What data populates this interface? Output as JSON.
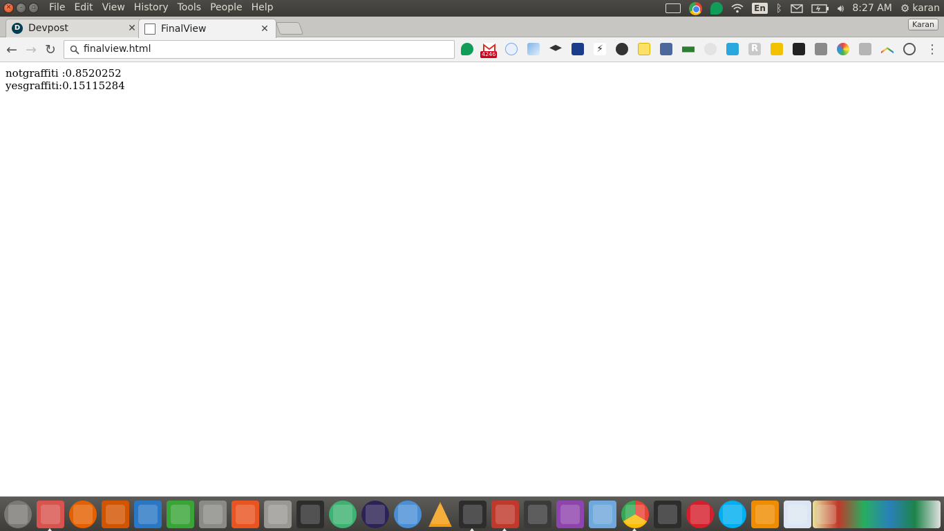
{
  "panel": {
    "menu": [
      "File",
      "Edit",
      "View",
      "History",
      "Tools",
      "People",
      "Help"
    ],
    "keyboard_layout": "En",
    "time": "8:27 AM",
    "user": "karan"
  },
  "tabs": [
    {
      "title": "Devpost",
      "favicon": "devpost-icon",
      "active": false
    },
    {
      "title": "FinalView",
      "favicon": "page-icon",
      "active": true
    }
  ],
  "profile": "Karan",
  "toolbar": {
    "url": "finalview.html",
    "gmail_badge": "4246"
  },
  "page": {
    "lines": [
      "notgraffiti :0.8520252",
      "yesgraffiti:0.15115284"
    ]
  },
  "colors": {
    "panel": "#3c3b37",
    "tabstrip": "#c7c6c2",
    "toolbar": "#f2f2f2",
    "dock": "#4a4945"
  }
}
